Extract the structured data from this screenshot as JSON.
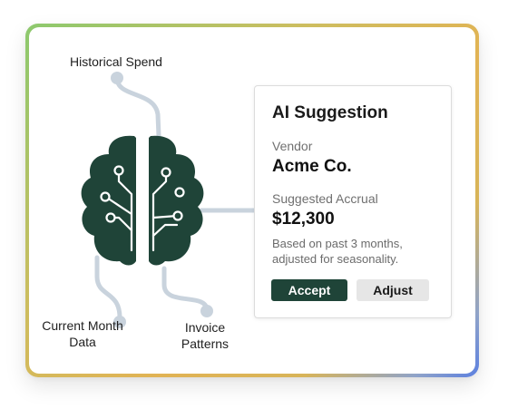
{
  "inputs": {
    "historical_spend": "Historical Spend",
    "current_month_data": "Current Month Data",
    "invoice_patterns": "Invoice Patterns"
  },
  "brain_icon": "brain-circuit-icon",
  "suggestion": {
    "title": "AI Suggestion",
    "vendor_label": "Vendor",
    "vendor_value": "Acme Co.",
    "accrual_label": "Suggested Accrual",
    "accrual_value": "$12,300",
    "note": "Based on past 3 months, adjusted for seasonality.",
    "accept_label": "Accept",
    "adjust_label": "Adjust"
  },
  "colors": {
    "brain": "#1f4438",
    "connector": "#c9d3dd",
    "accept_button": "#1f4438",
    "adjust_button": "#e6e6e6"
  }
}
